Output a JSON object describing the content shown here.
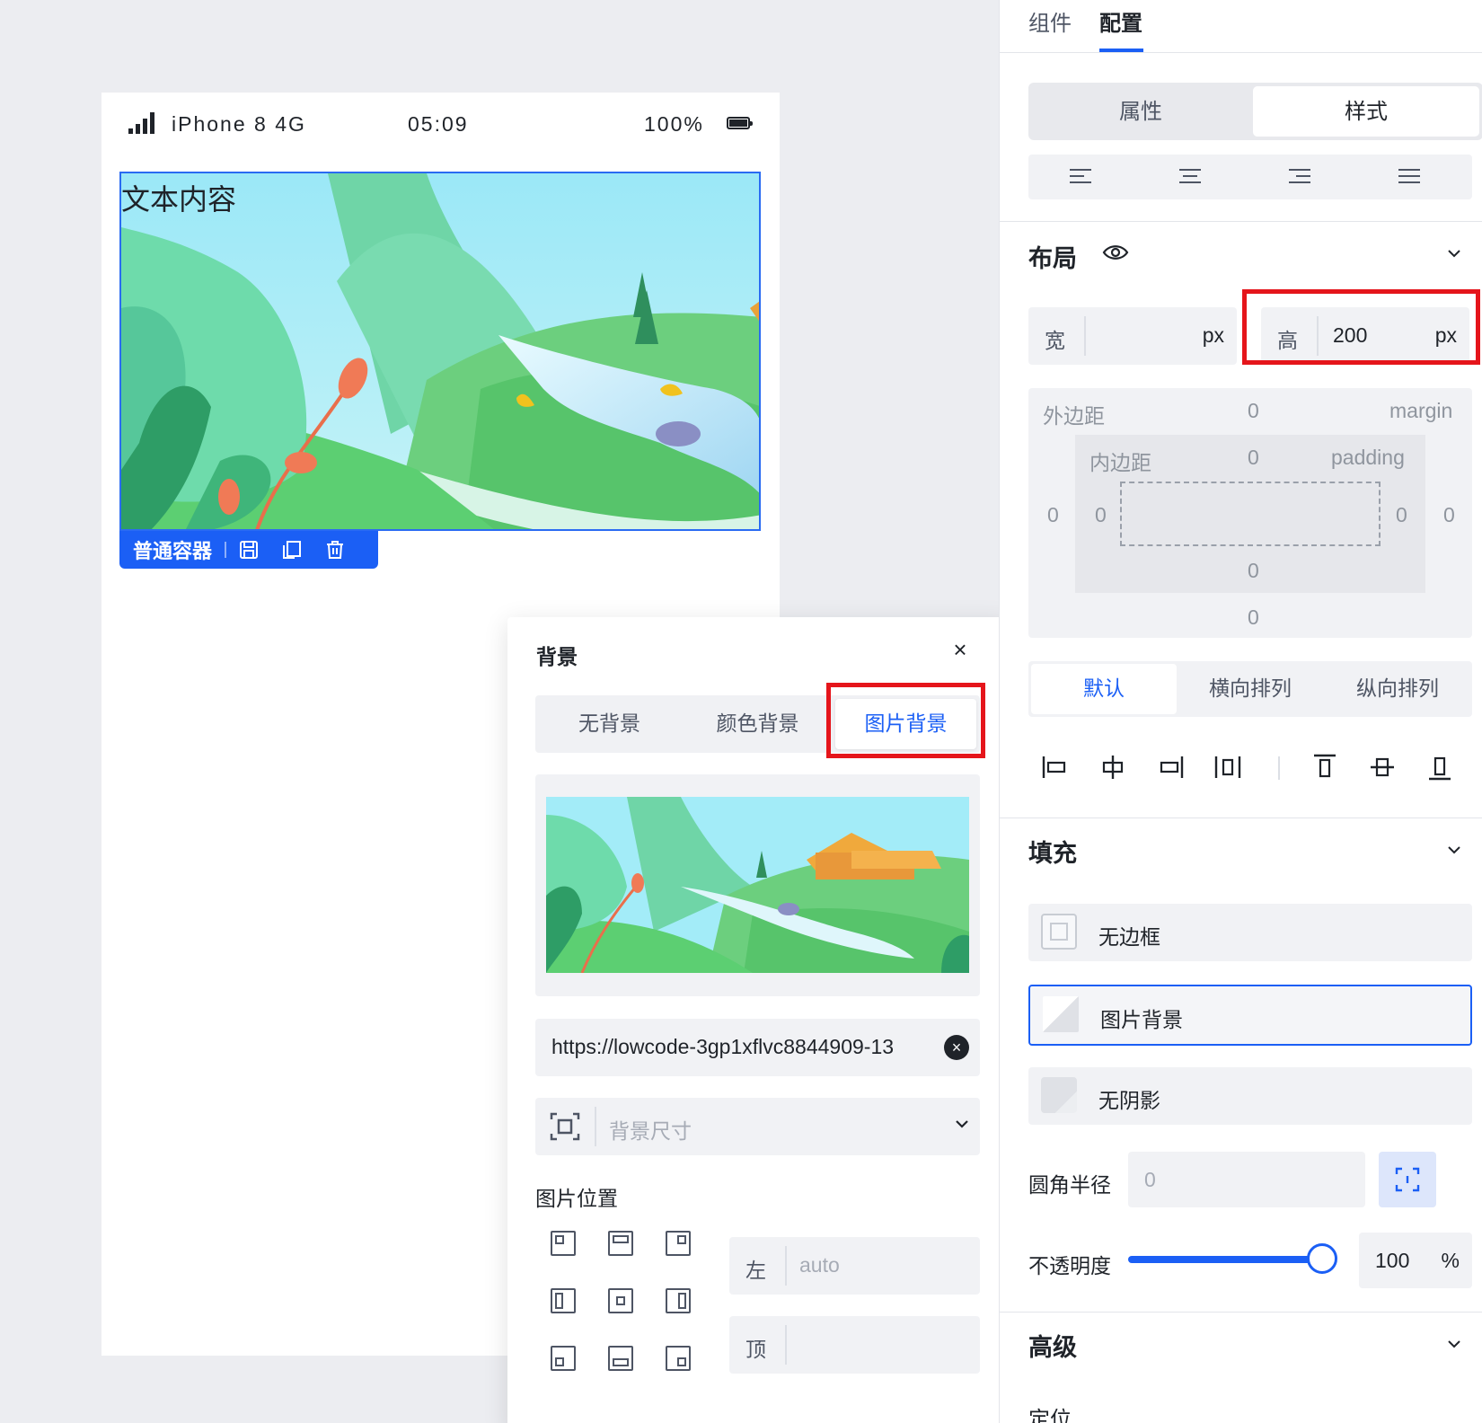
{
  "phone": {
    "carrier": "iPhone 8  4G",
    "time": "05:09",
    "battery": "100%",
    "container_text": "文本内容",
    "container_tag": "普通容器"
  },
  "bg_popover": {
    "title": "背景",
    "close": "×",
    "tabs": [
      "无背景",
      "颜色背景",
      "图片背景"
    ],
    "active_tab": "图片背景",
    "url": "https://lowcode-3gp1xflvc8844909-13",
    "url_clear": "×",
    "size_placeholder": "背景尺寸",
    "position_label": "图片位置",
    "left_label": "左",
    "left_value": "auto",
    "top_label": "顶",
    "top_value": ""
  },
  "panel": {
    "tabs": [
      "组件",
      "配置"
    ],
    "active_tab": "配置",
    "mode_tabs": [
      "属性",
      "样式"
    ],
    "active_mode": "样式",
    "layout_title": "布局",
    "width_label": "宽",
    "width_value": "",
    "width_unit": "px",
    "height_label": "高",
    "height_value": "200",
    "height_unit": "px",
    "margin_label": "外边距",
    "margin_en": "margin",
    "padding_label": "内边距",
    "padding_en": "padding",
    "margin": {
      "top": "0",
      "right": "0",
      "bottom": "0",
      "left": "0"
    },
    "padding": {
      "top": "0",
      "right": "0",
      "bottom": "0",
      "left": "0"
    },
    "arrange_tabs": [
      "默认",
      "横向排列",
      "纵向排列"
    ],
    "active_arrange": "默认",
    "fill_title": "填充",
    "border_option": "无边框",
    "background_option": "图片背景",
    "shadow_option": "无阴影",
    "radius_label": "圆角半径",
    "radius_value": "0",
    "opacity_label": "不透明度",
    "opacity_value": "100",
    "opacity_unit": "%",
    "opacity_fraction": 1.0,
    "advanced_title": "高级",
    "position_title": "定位"
  },
  "colors": {
    "accent": "#1b5ff5",
    "highlight_box": "#e5151b",
    "canvas_bg": "#ecedf1"
  },
  "icons": [
    "signal-icon",
    "battery-icon",
    "save-icon",
    "copy-icon",
    "delete-icon",
    "close-icon",
    "clear-icon",
    "resize-icon",
    "chevron-down-icon",
    "eye-icon",
    "align-left-icon",
    "align-center-icon",
    "align-right-icon",
    "align-justify-icon"
  ]
}
